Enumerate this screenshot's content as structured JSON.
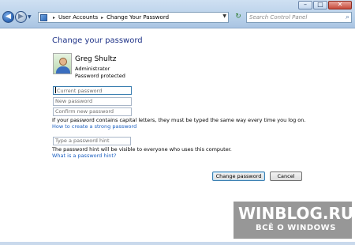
{
  "window": {
    "minimize_glyph": "–",
    "maximize_glyph": "□",
    "close_glyph": "✕"
  },
  "toolbar": {
    "back_glyph": "◀",
    "forward_glyph": "▶",
    "history_glyph": "▼",
    "refresh_glyph": "↻"
  },
  "address": {
    "separator": "▸",
    "crumbs": [
      "User Accounts",
      "Change Your Password"
    ],
    "dropdown_glyph": "▼"
  },
  "search": {
    "placeholder": "Search Control Panel",
    "icon": "search-icon",
    "icon_glyph": "⌕"
  },
  "main": {
    "heading": "Change your password",
    "user": {
      "name": "Greg Shultz",
      "role": "Administrator",
      "status": "Password protected"
    },
    "fields": {
      "current_password": "Current password",
      "new_password": "New password",
      "confirm_password": "Confirm new password",
      "password_hint": "Type a password hint"
    },
    "caps_note": "If your password contains capital letters, they must be typed the same way every time you log on.",
    "strong_password_link": "How to create a strong password",
    "hint_note": "The password hint will be visible to everyone who uses this computer.",
    "hint_link": "What is a password hint?",
    "buttons": {
      "change": "Change password",
      "cancel": "Cancel"
    }
  },
  "watermark": {
    "title": "WINBLOG.RU",
    "subtitle": "ВСЁ О WINDOWS"
  },
  "colors": {
    "heading": "#1e3287",
    "link": "#1a5fc1",
    "titlebar": "#b9d1ea"
  }
}
